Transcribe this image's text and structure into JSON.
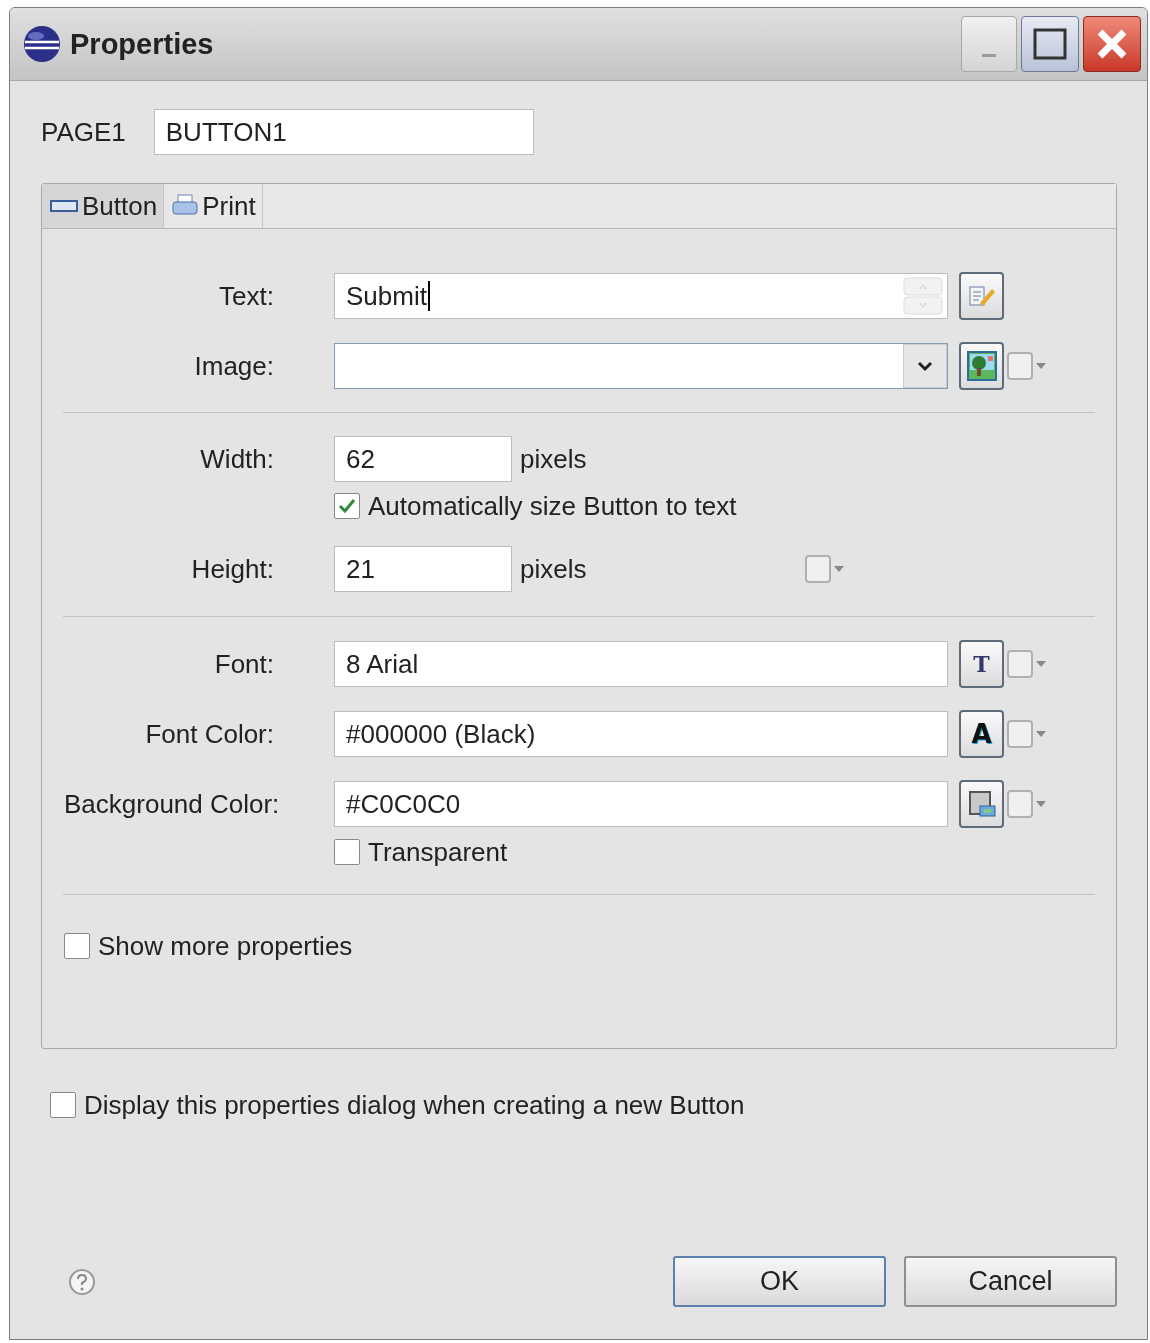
{
  "window": {
    "title": "Properties"
  },
  "header": {
    "label": "PAGE1",
    "value": "BUTTON1"
  },
  "tabs": [
    {
      "label": "Button",
      "selected": true
    },
    {
      "label": "Print",
      "selected": false
    }
  ],
  "sections": [
    {
      "items": [
        {
          "kind": "text",
          "label": "Text:",
          "value": "Submit",
          "option": false
        },
        {
          "kind": "image",
          "label": "Image:",
          "option": true
        }
      ]
    },
    {
      "items": [
        {
          "kind": "size",
          "label": "Width:",
          "value": "62",
          "unit": "pixels",
          "option": false
        },
        {
          "kind": "check",
          "label": "Automatically size Button to text",
          "checked": true
        },
        {
          "kind": "size",
          "label": "Height:",
          "value": "21",
          "unit": "pixels",
          "option": true
        }
      ]
    },
    {
      "items": [
        {
          "kind": "font",
          "label": "Font:",
          "value": "8 Arial",
          "glyph": "T",
          "option": true
        },
        {
          "kind": "color",
          "label": "Font Color:",
          "value": "#000000 (Black)",
          "glyph": "A",
          "option": true
        },
        {
          "kind": "fill",
          "label": "Background Color:",
          "value": "#C0C0C0",
          "option": true
        },
        {
          "kind": "check",
          "label": "Transparent",
          "checked": false
        }
      ]
    },
    {
      "items": [
        {
          "kind": "wide-check",
          "label": "Show more properties",
          "checked": false
        }
      ]
    }
  ],
  "footer_check": {
    "label": "Display this properties dialog when creating a new Button",
    "checked": false
  },
  "buttons": [
    {
      "label": "OK",
      "default": true
    },
    {
      "label": "Cancel",
      "default": false
    }
  ]
}
